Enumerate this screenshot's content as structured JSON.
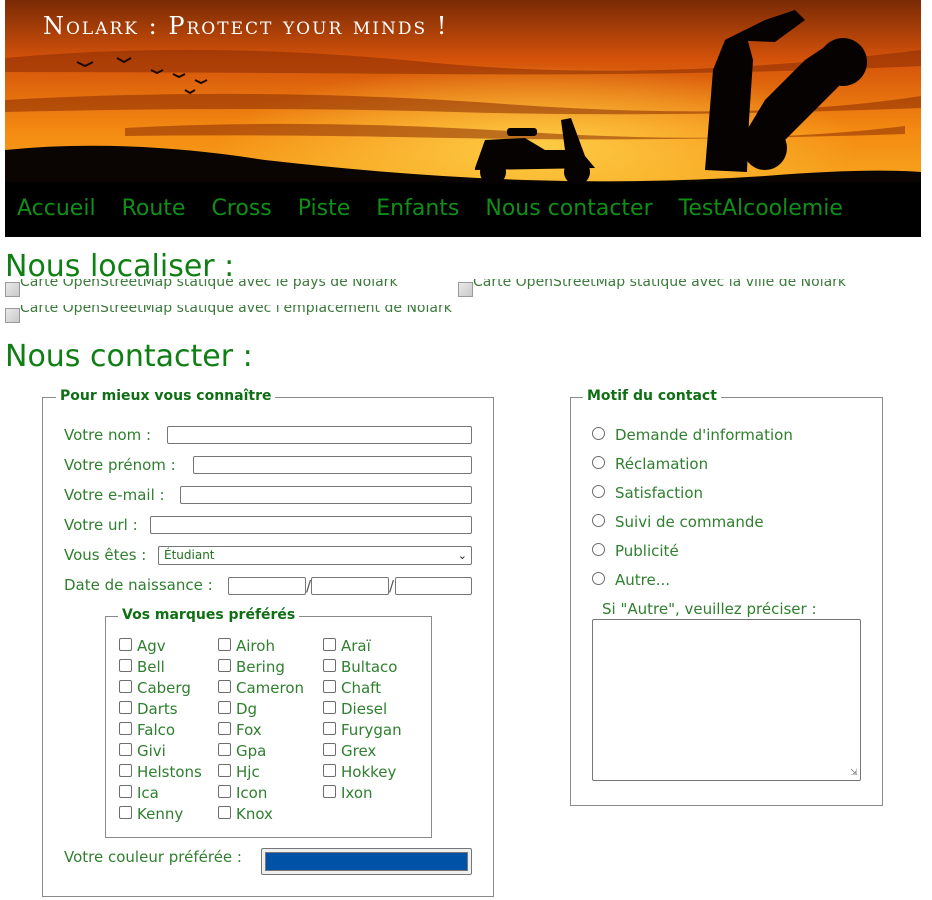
{
  "brand": {
    "title": "Nolark : Protect your minds !"
  },
  "nav": [
    "Accueil",
    "Route",
    "Cross",
    "Piste",
    "Enfants",
    "Nous contacter",
    "TestAlcoolemie"
  ],
  "localiser": {
    "title": "Nous localiser :",
    "maps": [
      "Carte OpenStreetMap statique avec le pays de Nolark",
      "Carte OpenStreetMap statique avec la ville de Nolark",
      "Carte OpenStreetMap statique avec l'emplacement de Nolark"
    ]
  },
  "contact": {
    "title": "Nous contacter :",
    "identity": {
      "legend": "Pour mieux vous connaître",
      "nom": "Votre nom :",
      "prenom": "Votre prénom :",
      "email": "Votre e-mail :",
      "url": "Votre url :",
      "statut": "Vous êtes :",
      "statut_value": "Étudiant",
      "naissance": "Date de naissance :",
      "date_sep": "/",
      "couleur": "Votre couleur préférée :",
      "couleur_value": "#0052a6"
    },
    "marques": {
      "legend": "Vos marques préférés",
      "items": [
        "Agv",
        "Airoh",
        "Araï",
        "Bell",
        "Bering",
        "Bultaco",
        "Caberg",
        "Cameron",
        "Chaft",
        "Darts",
        "Dg",
        "Diesel",
        "Falco",
        "Fox",
        "Furygan",
        "Givi",
        "Gpa",
        "Grex",
        "Helstons",
        "Hjc",
        "Hokkey",
        "Ica",
        "Icon",
        "Ixon",
        "Kenny",
        "Knox"
      ]
    },
    "motif": {
      "legend": "Motif du contact",
      "options": [
        "Demande d'information",
        "Réclamation",
        "Satisfaction",
        "Suivi de commande",
        "Publicité",
        "Autre..."
      ],
      "autre_label": "Si \"Autre\", veuillez préciser :"
    }
  },
  "colors": {
    "green": "#0f7f14",
    "accent_blue": "#0052a6"
  }
}
